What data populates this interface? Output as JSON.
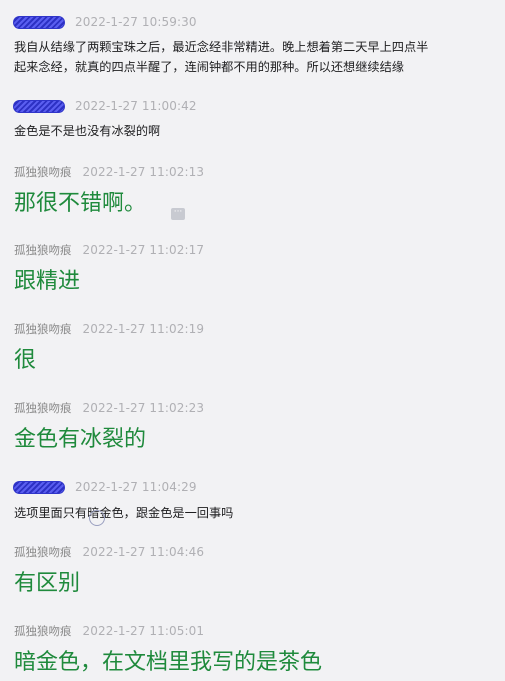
{
  "messages": [
    {
      "sender": "",
      "redacted": true,
      "time": "2022-1-27 10:59:30",
      "lines": [
        "我自从结缘了两颗宝珠之后，最近念经非常精进。晚上想着第二天早上四点半",
        "起来念经，就真的四点半醒了，连闹钟都不用的那种。所以还想继续结缘"
      ],
      "style": "small"
    },
    {
      "sender": "",
      "redacted": true,
      "time": "2022-1-27 11:00:42",
      "lines": [
        "金色是不是也没有冰裂的啊"
      ],
      "style": "small"
    },
    {
      "sender": "孤独狼吻痕",
      "redacted": false,
      "time": "2022-1-27 11:02:13",
      "lines": [
        "那很不错啊。"
      ],
      "style": "big"
    },
    {
      "sender": "孤独狼吻痕",
      "redacted": false,
      "time": "2022-1-27 11:02:17",
      "lines": [
        "跟精进"
      ],
      "style": "big"
    },
    {
      "sender": "孤独狼吻痕",
      "redacted": false,
      "time": "2022-1-27 11:02:19",
      "lines": [
        "很"
      ],
      "style": "big"
    },
    {
      "sender": "孤独狼吻痕",
      "redacted": false,
      "time": "2022-1-27 11:02:23",
      "lines": [
        "金色有冰裂的"
      ],
      "style": "big"
    },
    {
      "sender": "",
      "redacted": true,
      "time": "2022-1-27 11:04:29",
      "lines": [
        "选项里面只有暗金色，跟金色是一回事吗"
      ],
      "style": "small"
    },
    {
      "sender": "孤独狼吻痕",
      "redacted": false,
      "time": "2022-1-27 11:04:46",
      "lines": [
        "有区别"
      ],
      "style": "big"
    },
    {
      "sender": "孤独狼吻痕",
      "redacted": false,
      "time": "2022-1-27 11:05:01",
      "lines": [
        "暗金色，在文档里我写的是茶色"
      ],
      "style": "big"
    }
  ],
  "more_button": {
    "icon": "more-dots-icon",
    "glyph": "···"
  },
  "colors": {
    "reply_text": "#1f8a3c",
    "timestamp": "#b0b0b4",
    "background": "#f2f2f4",
    "redaction": "#3b3fd8"
  }
}
